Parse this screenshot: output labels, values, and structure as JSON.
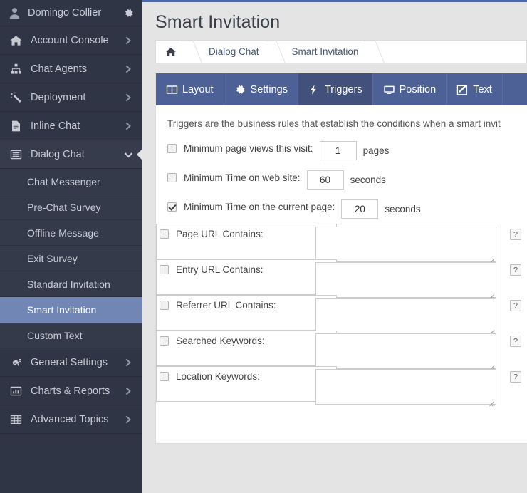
{
  "sidebar": {
    "user": {
      "name": "Domingo Collier",
      "avatar_icon": "user-icon",
      "gear_icon": "gear-icon"
    },
    "items": [
      {
        "label": "Account Console",
        "icon": "home-icon",
        "arrow": "chevron-right-icon",
        "open": false
      },
      {
        "label": "Chat Agents",
        "icon": "sitemap-icon",
        "arrow": "chevron-right-icon",
        "open": false
      },
      {
        "label": "Deployment",
        "icon": "magic-wand-icon",
        "arrow": "chevron-right-icon",
        "open": false
      },
      {
        "label": "Inline Chat",
        "icon": "document-icon",
        "arrow": "chevron-right-icon",
        "open": false
      },
      {
        "label": "Dialog Chat",
        "icon": "list-window-icon",
        "arrow": "chevron-down-icon",
        "open": true
      }
    ],
    "submenu": [
      {
        "label": "Chat Messenger",
        "active": false
      },
      {
        "label": "Pre-Chat Survey",
        "active": false
      },
      {
        "label": "Offline Message",
        "active": false
      },
      {
        "label": "Exit Survey",
        "active": false
      },
      {
        "label": "Standard Invitation",
        "active": false
      },
      {
        "label": "Smart Invitation",
        "active": true
      },
      {
        "label": "Custom Text",
        "active": false
      }
    ],
    "items_bottom": [
      {
        "label": "General Settings",
        "icon": "gears-icon",
        "arrow": "chevron-right-icon"
      },
      {
        "label": "Charts & Reports",
        "icon": "bar-chart-icon",
        "arrow": "chevron-right-icon"
      },
      {
        "label": "Advanced Topics",
        "icon": "table-grid-icon",
        "arrow": "chevron-right-icon"
      }
    ]
  },
  "header": {
    "title": "Smart Invitation",
    "breadcrumb": {
      "home_icon": "home-icon",
      "items": [
        "Dialog Chat",
        "Smart Invitation"
      ]
    }
  },
  "tabs": [
    {
      "label": "Layout",
      "icon": "columns-icon",
      "active": false
    },
    {
      "label": "Settings",
      "icon": "gear-icon",
      "active": false
    },
    {
      "label": "Triggers",
      "icon": "bolt-icon",
      "active": true
    },
    {
      "label": "Position",
      "icon": "monitor-icon",
      "active": false
    },
    {
      "label": "Text",
      "icon": "edit-pen-icon",
      "active": false
    }
  ],
  "main": {
    "intro": "Triggers are the business rules that establish the conditions when a smart invit",
    "help_label": "?",
    "rows": [
      {
        "type": "number",
        "label": "Minimum page views this visit:",
        "checked": false,
        "value": "1",
        "unit": "pages"
      },
      {
        "type": "number",
        "label": "Minimum Time on web site:",
        "checked": false,
        "value": "60",
        "unit": "seconds"
      },
      {
        "type": "number",
        "label": "Minimum Time on the current page:",
        "checked": true,
        "value": "20",
        "unit": "seconds"
      },
      {
        "type": "textarea",
        "label": "Page URL Contains:",
        "checked": false,
        "value": ""
      },
      {
        "type": "textarea",
        "label": "Entry URL Contains:",
        "checked": false,
        "value": ""
      },
      {
        "type": "textarea",
        "label": "Referrer URL Contains:",
        "checked": false,
        "value": ""
      },
      {
        "type": "textarea",
        "label": "Searched Keywords:",
        "checked": false,
        "value": ""
      },
      {
        "type": "textarea",
        "label": "Location Keywords:",
        "checked": false,
        "value": ""
      }
    ]
  },
  "colors": {
    "sidebar_bg": "#2f3544",
    "sidebar_active": "#7286b5",
    "tabbar": "#4e6196",
    "tab_active": "#41517c",
    "accent_top": "#4b69a8",
    "page_bg": "#e4e4e4"
  }
}
